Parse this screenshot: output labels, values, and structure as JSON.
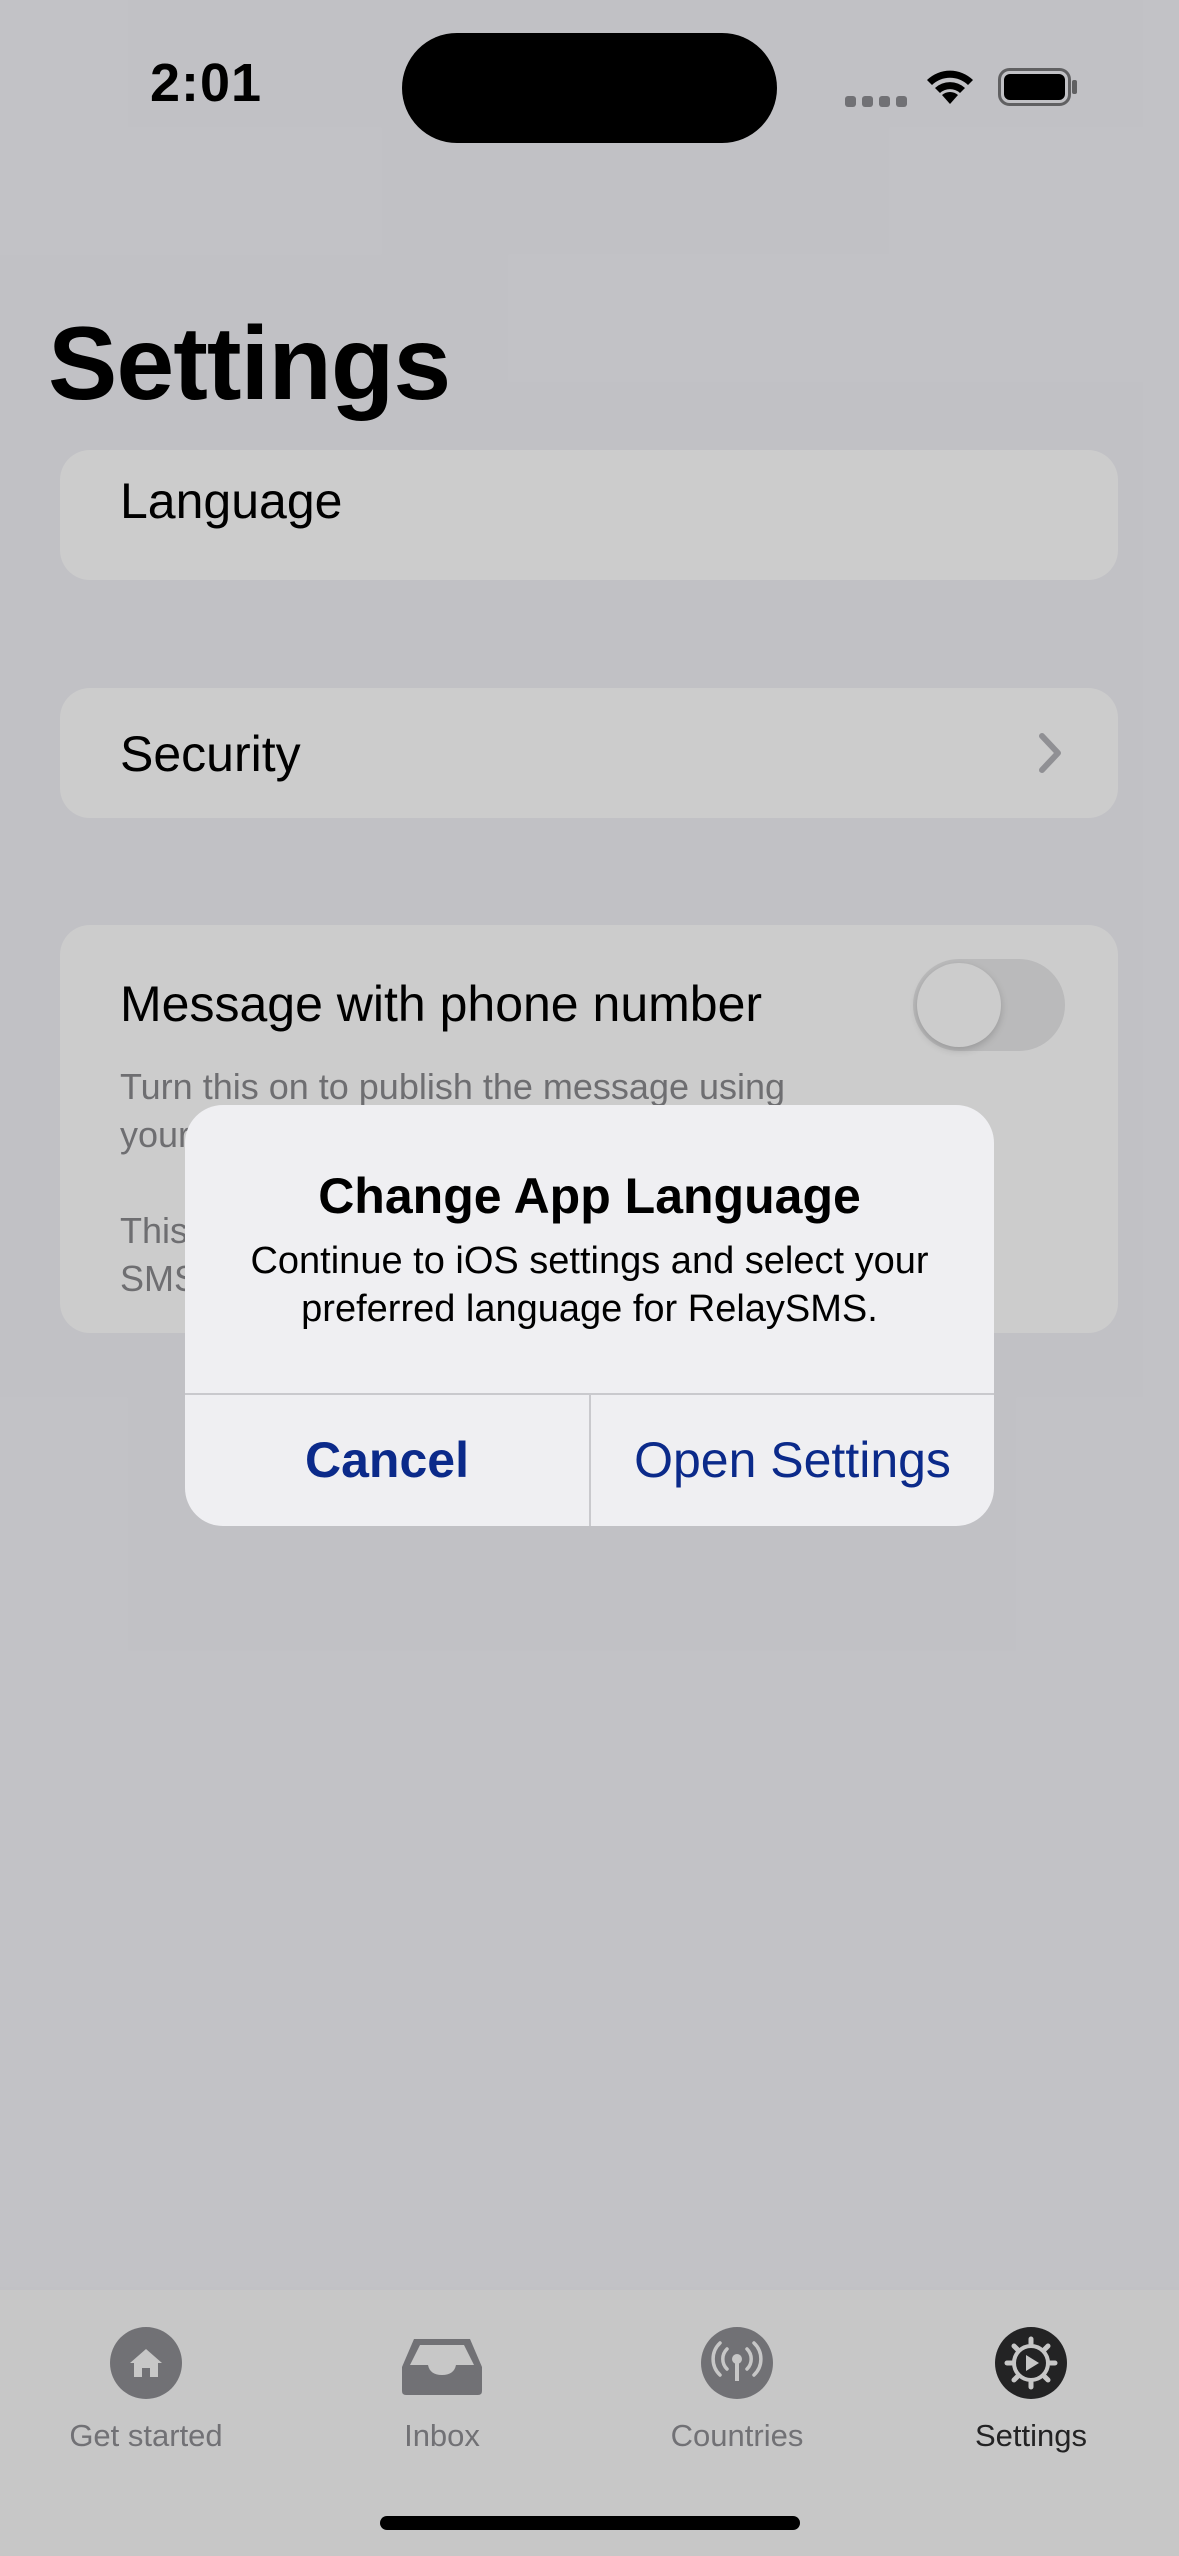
{
  "status_bar": {
    "time": "2:01"
  },
  "page": {
    "title": "Settings"
  },
  "sections": {
    "language": {
      "label": "Language"
    },
    "security": {
      "label": "Security"
    },
    "message": {
      "label": "Message with phone number",
      "toggle_on": false,
      "description_line1": "Turn this on to publish the message using",
      "description_line1b": "your",
      "description_line2a": "This",
      "description_line2b": "SMS"
    }
  },
  "alert": {
    "title": "Change App Language",
    "message": "Continue to iOS settings and select your preferred language for RelaySMS.",
    "cancel_label": "Cancel",
    "confirm_label": "Open Settings"
  },
  "tabbar": {
    "items": [
      {
        "label": "Get started",
        "icon": "home-icon",
        "active": false
      },
      {
        "label": "Inbox",
        "icon": "inbox-icon",
        "active": false
      },
      {
        "label": "Countries",
        "icon": "antenna-icon",
        "active": false
      },
      {
        "label": "Settings",
        "icon": "gear-icon",
        "active": true
      }
    ]
  },
  "colors": {
    "accent": "#0b2a8a",
    "background": "#f2f2f7",
    "card": "#ffffff"
  }
}
